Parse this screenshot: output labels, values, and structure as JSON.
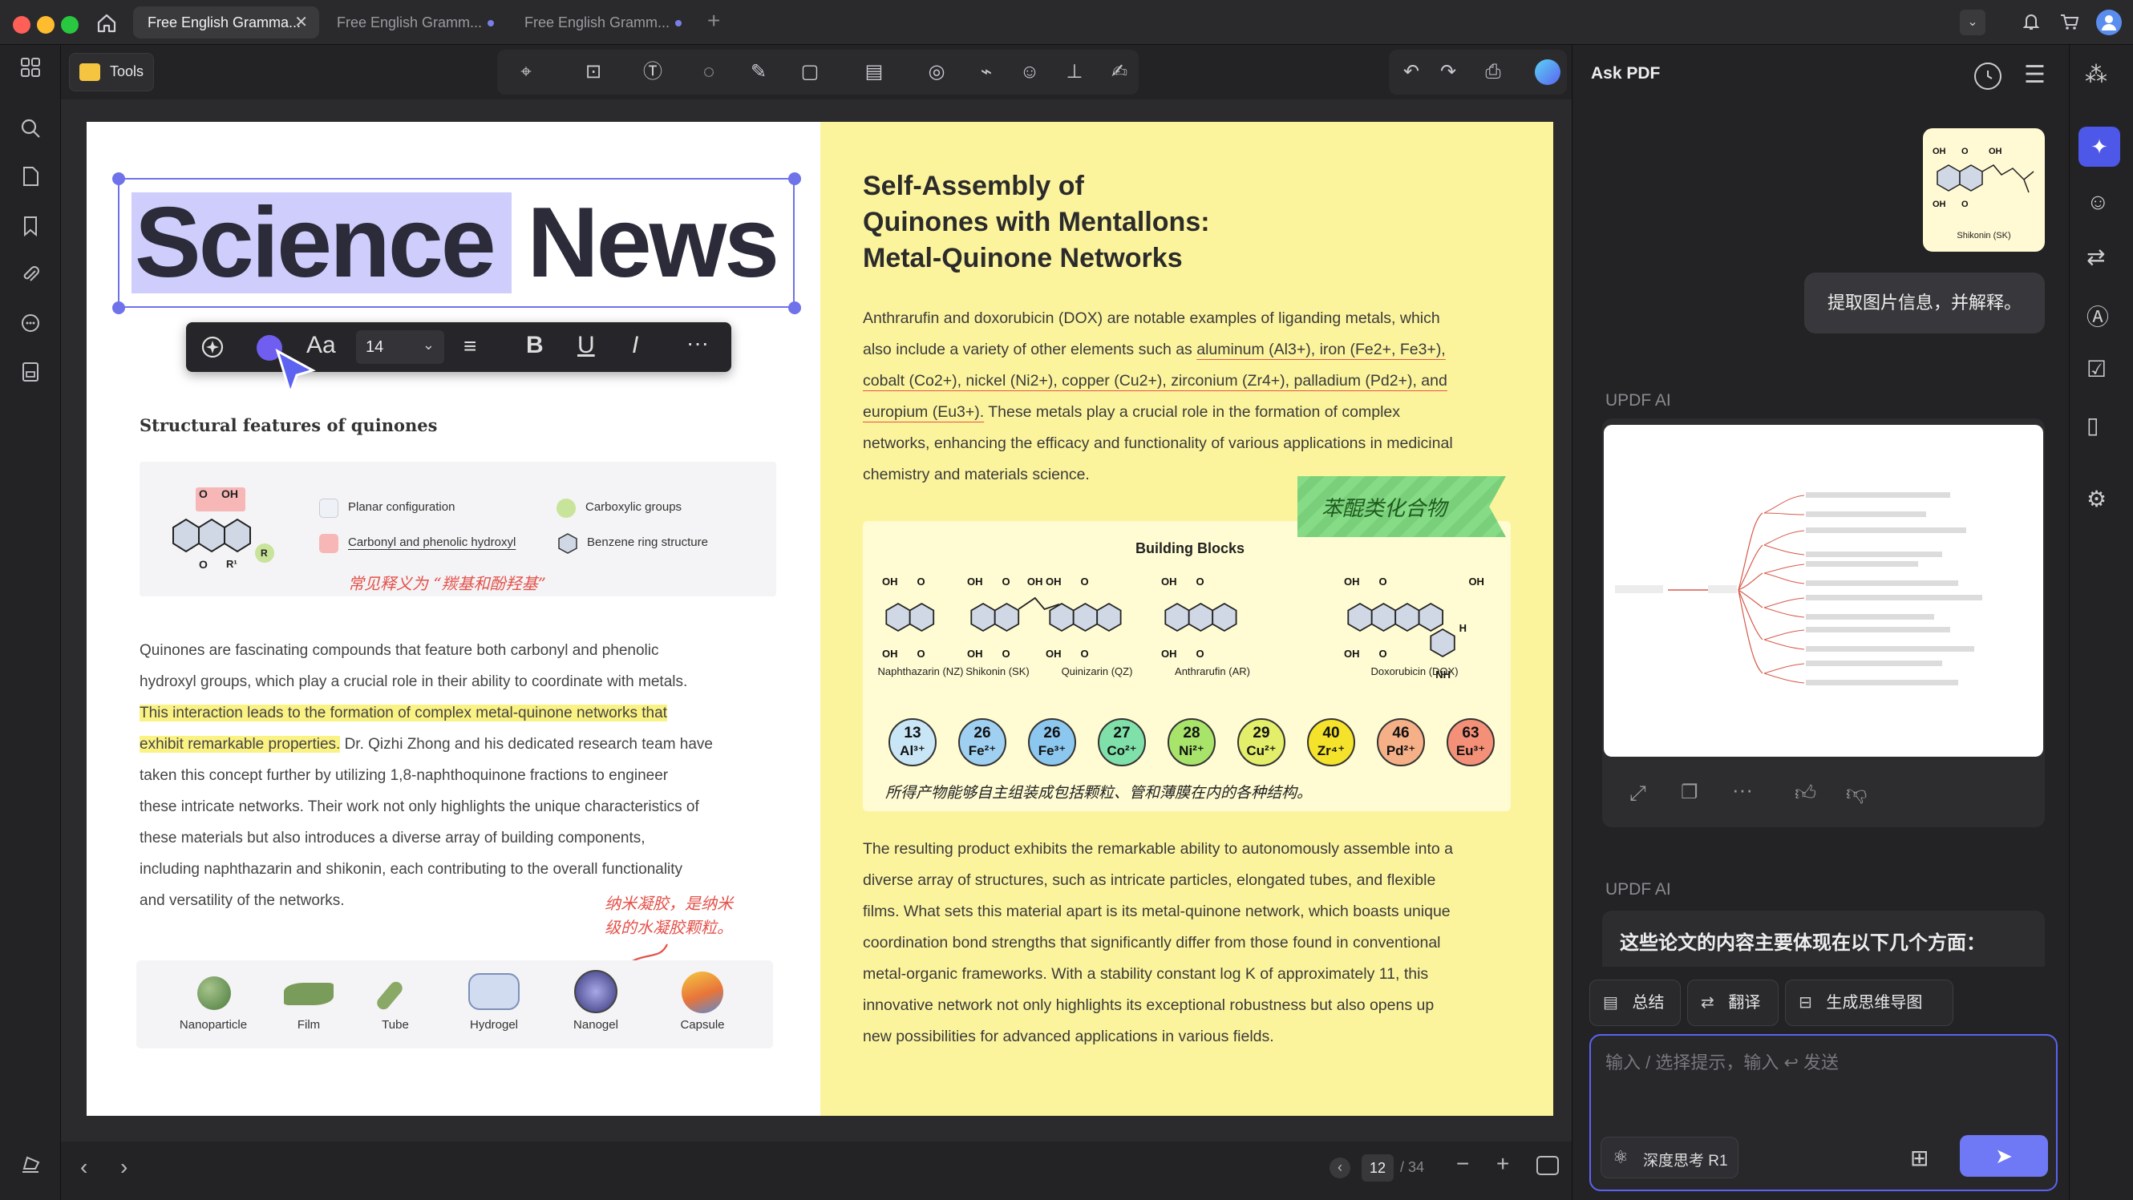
{
  "tabs": [
    {
      "label": "Free English Gramma..."
    },
    {
      "label": "Free English Gramm..."
    },
    {
      "label": "Free English Gramm..."
    }
  ],
  "toolbar": {
    "tools_label": "Tools"
  },
  "left_page": {
    "title_word1": "Science",
    "title_word2": "News",
    "format_bar": {
      "font_button": "Aa",
      "font_size": "14"
    },
    "section_title": "Structural features of quinones",
    "legend": {
      "planar": "Planar configuration",
      "carboxylic": "Carboxylic groups",
      "carbonyl": "Carbonyl and phenolic hydroxyl",
      "benzene": "Benzene ring structure",
      "handwritten": "常见释义为 “羰基和酚羟基”"
    },
    "molecule_labels": {
      "o": "O",
      "oh": "OH",
      "r": "R",
      "r1": "R¹"
    },
    "paragraph": {
      "line1": "Quinones are fascinating compounds that feature both carbonyl and phenolic",
      "line2": "hydroxyl groups, which play a crucial role in their ability to coordinate with metals.",
      "line3_hl": "This interaction leads to the formation of complex metal-quinone networks that",
      "line4_hl": "exhibit remarkable properties.",
      "line4_rest": " Dr. Qizhi Zhong and his dedicated research team have",
      "line5": "taken this concept further by utilizing 1,8-naphthoquinone fractions to engineer",
      "line6": "these intricate networks. Their work not only highlights the unique characteristics of",
      "line7": "these materials but also introduces a diverse array of building components,",
      "line8": "including naphthazarin and shikonin, each contributing to the overall functionality",
      "line9": "and versatility of the networks."
    },
    "handnote_line1": "纳米凝胶，是纳米",
    "handnote_line2": "级的水凝胶颗粒。",
    "components": [
      "Nanoparticle",
      "Film",
      "Tube",
      "Hydrogel",
      "Nanogel",
      "Capsule"
    ]
  },
  "right_page": {
    "title_line1": "Self-Assembly of",
    "title_line2": "Quinones with Mentallons:",
    "title_line3": "Metal-Quinone Networks",
    "para1": {
      "l1": "Anthrarufin and doxorubicin (DOX) are notable examples of liganding metals, which",
      "l2_a": "also include a variety of other elements such as ",
      "l2_ul": "aluminum (Al3+), iron (Fe2+, Fe3+),",
      "l3_ul": "cobalt (Co2+), nickel (Ni2+), copper (Cu2+), zirconium (Zr4+), palladium (Pd2+), and",
      "l4_ul": "europium (Eu3+).",
      "l4_rest": " These metals play a crucial role in the formation of complex",
      "l5": "networks, enhancing the efficacy and functionality of various applications in medicinal",
      "l6": "chemistry and materials science."
    },
    "sticky_note": "苯醌类化合物",
    "building_blocks": {
      "title": "Building Blocks",
      "molecules": [
        "Naphthazarin (NZ)",
        "Shikonin (SK)",
        "Quinizarin (QZ)",
        "Anthrarufin (AR)",
        "Doxorubicin (DOX)"
      ],
      "atom_labels": {
        "o": "O",
        "oh": "OH",
        "nh": "NH",
        "h": "H"
      },
      "metals": [
        {
          "num": "13",
          "sym": "Al³⁺",
          "color": "#c8e6f5"
        },
        {
          "num": "26",
          "sym": "Fe²⁺",
          "color": "#9fd0f2"
        },
        {
          "num": "26",
          "sym": "Fe³⁺",
          "color": "#8cc7f0"
        },
        {
          "num": "27",
          "sym": "Co²⁺",
          "color": "#7fe0a9"
        },
        {
          "num": "28",
          "sym": "Ni²⁺",
          "color": "#a8e36a"
        },
        {
          "num": "29",
          "sym": "Cu²⁺",
          "color": "#e3ef6a"
        },
        {
          "num": "40",
          "sym": "Zr⁴⁺",
          "color": "#f5e22a"
        },
        {
          "num": "46",
          "sym": "Pd²⁺",
          "color": "#f5b088"
        },
        {
          "num": "63",
          "sym": "Eu³⁺",
          "color": "#f59078"
        }
      ],
      "handwritten": "所得产物能够自主组装成包括颗粒、管和薄膜在内的各种结构。"
    },
    "para2": {
      "l1": "The resulting product exhibits the remarkable ability to autonomously assemble into a",
      "l2": "diverse array of structures, such as intricate particles, elongated tubes, and flexible",
      "l3": "films. What sets this material apart is its metal-quinone network, which boasts unique",
      "l4": "coordination bond strengths that significantly differ from those found in conventional",
      "l5": "metal-organic frameworks. With a stability constant log K of approximately 11, this",
      "l6": "innovative network not only highlights its exceptional robustness but also opens up",
      "l7": "new possibilities for advanced applications in various fields."
    }
  },
  "pagination": {
    "current": "12",
    "total": "/ 34"
  },
  "ask_pdf": {
    "title": "Ask PDF",
    "image_caption": "Shikonin (SK)",
    "user_message": "提取图片信息，并解释。",
    "ai_label_1": "UPDF AI",
    "ai_label_2": "UPDF AI",
    "ai_response_heading": "这些论文的内容主要体现在以下几个方面：",
    "actions": {
      "summarize": "总结",
      "translate": "翻译",
      "mindmap": "生成思维导图"
    },
    "input_placeholder": "输入 / 选择提示，输入 ↩ 发送",
    "deep_think": "深度思考 R1"
  },
  "colors": {
    "accent": "#5b63f0",
    "highlight_title": "#cfcdfc",
    "highlight_text": "#fbf284",
    "right_page_bg": "#fcf49c",
    "sticky_note": "#7fd67f",
    "handwriting": "#e4514a"
  }
}
